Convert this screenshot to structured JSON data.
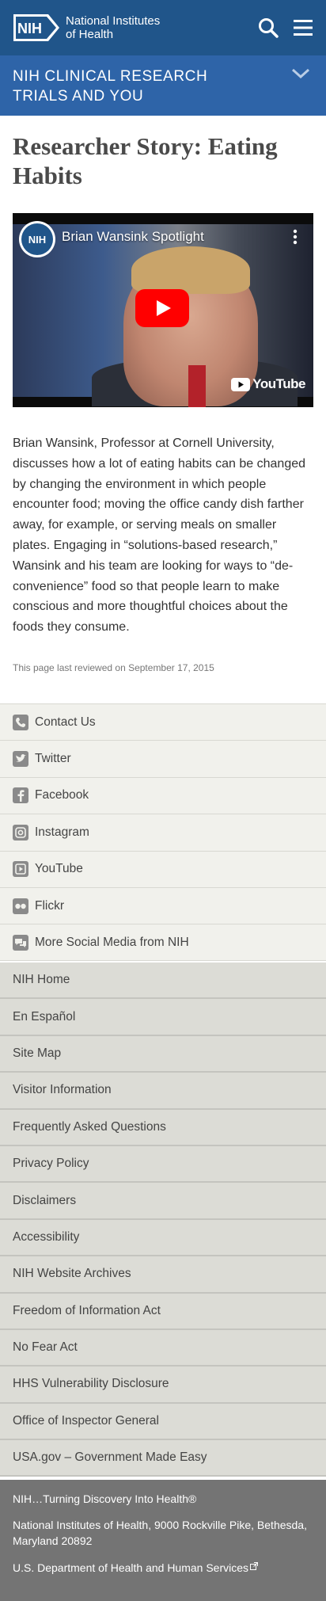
{
  "header": {
    "logo_abbr": "NIH",
    "logo_line1": "National Institutes",
    "logo_line2": "of Health",
    "search_icon": "search-icon",
    "menu_icon": "hamburger-menu-icon",
    "bg_color": "#20558a"
  },
  "section": {
    "title": "NIH CLINICAL RESEARCH TRIALS AND YOU",
    "chevron_icon": "chevron-down-icon",
    "bg_color": "#2e64a8"
  },
  "main": {
    "title": "Researcher Story: Eating Habits",
    "video": {
      "channel_abbr": "NIH",
      "title": "Brian Wansink Spotlight",
      "brand": "YouTube",
      "play_icon": "play-button-icon",
      "more_icon": "more-vertical-icon"
    },
    "body": "Brian Wansink, Professor at Cornell University, discusses how a lot of eating habits can be changed by changing the environment in which people encounter food; moving the office candy dish farther away, for example, or serving meals on smaller plates. Engaging in “solutions-based research,” Wansink and his team are looking for ways to “de-convenience” food so that people learn to make conscious and more thoughtful choices about the foods they consume.",
    "reviewed": "This page last reviewed on September 17, 2015"
  },
  "social": [
    {
      "label": "Contact Us",
      "icon": "phone-icon"
    },
    {
      "label": "Twitter",
      "icon": "twitter-icon"
    },
    {
      "label": "Facebook",
      "icon": "facebook-icon"
    },
    {
      "label": "Instagram",
      "icon": "instagram-icon"
    },
    {
      "label": "YouTube",
      "icon": "youtube-icon"
    },
    {
      "label": "Flickr",
      "icon": "flickr-icon"
    },
    {
      "label": "More Social Media from NIH",
      "icon": "social-media-icon"
    }
  ],
  "links": [
    "NIH Home",
    "En Español",
    "Site Map",
    "Visitor Information",
    "Frequently Asked Questions",
    "Privacy Policy",
    "Disclaimers",
    "Accessibility",
    "NIH Website Archives",
    "Freedom of Information Act",
    "No Fear Act",
    "HHS Vulnerability Disclosure",
    "Office of Inspector General",
    "USA.gov – Government Made Easy"
  ],
  "footer": {
    "tagline": "NIH…Turning Discovery Into Health®",
    "address": "National Institutes of Health, 9000 Rockville Pike, Bethesda, Maryland 20892",
    "hhs": "U.S. Department of Health and Human Services",
    "external_icon": "external-link-icon",
    "bg_color": "#747474"
  }
}
